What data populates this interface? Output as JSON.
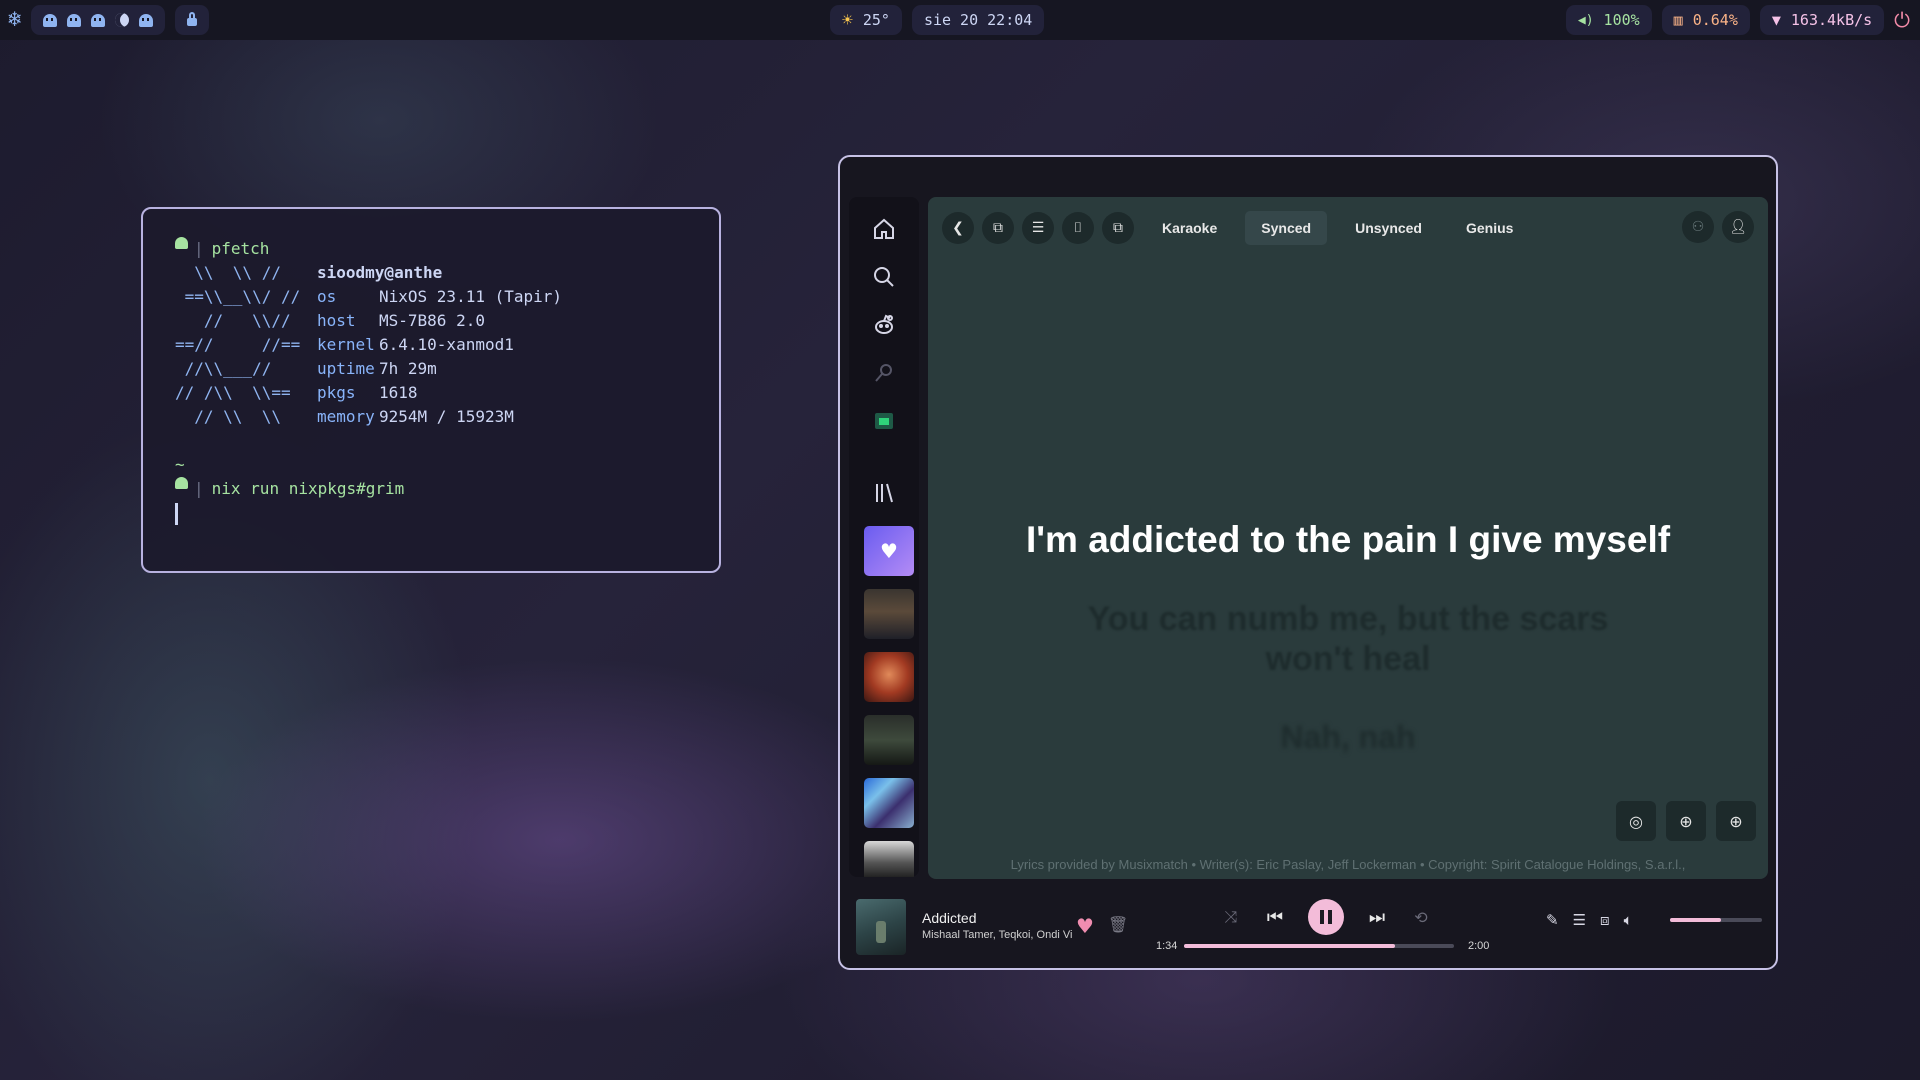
{
  "topbar": {
    "weather_temp": "25°",
    "datetime": "sie 20 22:04",
    "volume": "100%",
    "cpu": "0.64%",
    "network": "163.4kB/s"
  },
  "terminal": {
    "prompt_cmd1": "pfetch",
    "logo_lines": [
      "  \\\\  \\\\ //",
      " ==\\\\__\\\\/ //",
      "   //   \\\\//",
      "==//     //==",
      " //\\\\___//",
      "// /\\\\  \\\\==",
      "  // \\\\  \\\\"
    ],
    "info": [
      {
        "key": "",
        "value": "sioodmy@anthe"
      },
      {
        "key": "os",
        "value": "NixOS 23.11 (Tapir)"
      },
      {
        "key": "host",
        "value": "MS-7B86 2.0"
      },
      {
        "key": "kernel",
        "value": "6.4.10-xanmod1"
      },
      {
        "key": "uptime",
        "value": "7h 29m"
      },
      {
        "key": "pkgs",
        "value": "1618"
      },
      {
        "key": "memory",
        "value": "9254M / 15923M"
      }
    ],
    "tilde": "~",
    "prompt_cmd2": "nix run nixpkgs#grim"
  },
  "spotify": {
    "tabs": [
      "Karaoke",
      "Synced",
      "Unsynced",
      "Genius"
    ],
    "active_tab": "Synced",
    "lyrics": {
      "current": "I'm addicted to the pain I give myself",
      "next": "You can numb me, but the scars won't heal",
      "next2": "Nah, nah"
    },
    "credits": "Lyrics provided by Musixmatch • Writer(s): Eric Paslay, Jeff Lockerman • Copyright: Spirit Catalogue Holdings, S.a.r.l.,",
    "player": {
      "track": "Addicted",
      "artists": "Mishaal Tamer, Teqkoi, Ondi Vil",
      "elapsed": "1:34",
      "duration": "2:00",
      "progress": 0.78,
      "volume": 0.55
    }
  },
  "colors": {
    "accent": "#f3bcd9",
    "terminal_border": "#b8b2e0",
    "lyrics_bg": "#2a3b3c"
  }
}
